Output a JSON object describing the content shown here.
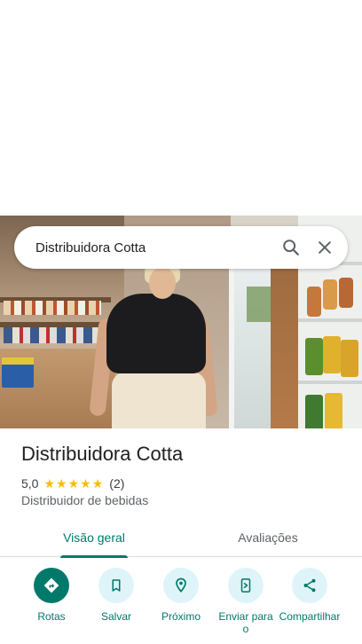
{
  "search": {
    "query": "Distribuidora Cotta"
  },
  "place": {
    "name": "Distribuidora Cotta",
    "rating": "5,0",
    "stars": 5,
    "review_count": "(2)",
    "category": "Distribuidor de bebidas"
  },
  "tabs": [
    {
      "label": "Visão geral",
      "selected": true
    },
    {
      "label": "Avaliações",
      "selected": false
    }
  ],
  "actions": [
    {
      "label": "Rotas",
      "icon": "directions-icon"
    },
    {
      "label": "Salvar",
      "icon": "bookmark-icon"
    },
    {
      "label": "Próximo",
      "icon": "nearby-icon"
    },
    {
      "label": "Enviar para o",
      "icon": "send-to-phone-icon"
    },
    {
      "label": "Compartilhar",
      "icon": "share-icon"
    }
  ],
  "colors": {
    "accent": "#00796b",
    "chip_bg": "#dff4f8",
    "star": "#fbbc04"
  }
}
